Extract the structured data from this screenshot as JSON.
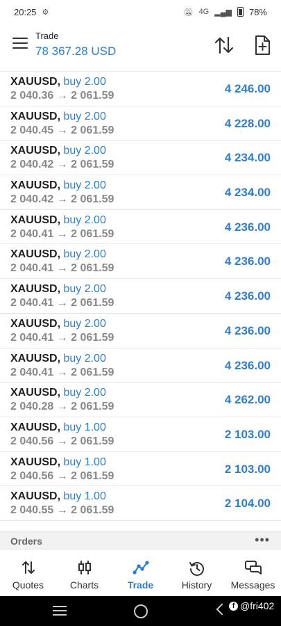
{
  "status_bar": {
    "time": "20:25",
    "network": "4G",
    "battery": "78%",
    "icons": [
      "settings-gear-icon",
      "mute-icon",
      "volte-icon",
      "signal-icon",
      "battery-icon"
    ]
  },
  "header": {
    "title": "Trade",
    "balance": "78 367.28 USD",
    "icons": [
      "menu-icon",
      "sort-icon",
      "new-order-icon"
    ]
  },
  "positions": [
    {
      "symbol": "XAUUSD,",
      "type": "buy 2.00",
      "prices": "2 040.36 → 2 061.59",
      "profit": "4 246.00"
    },
    {
      "symbol": "XAUUSD,",
      "type": "buy 2.00",
      "prices": "2 040.45 → 2 061.59",
      "profit": "4 228.00"
    },
    {
      "symbol": "XAUUSD,",
      "type": "buy 2.00",
      "prices": "2 040.42 → 2 061.59",
      "profit": "4 234.00"
    },
    {
      "symbol": "XAUUSD,",
      "type": "buy 2.00",
      "prices": "2 040.42 → 2 061.59",
      "profit": "4 234.00"
    },
    {
      "symbol": "XAUUSD,",
      "type": "buy 2.00",
      "prices": "2 040.41 → 2 061.59",
      "profit": "4 236.00"
    },
    {
      "symbol": "XAUUSD,",
      "type": "buy 2.00",
      "prices": "2 040.41 → 2 061.59",
      "profit": "4 236.00"
    },
    {
      "symbol": "XAUUSD,",
      "type": "buy 2.00",
      "prices": "2 040.41 → 2 061.59",
      "profit": "4 236.00"
    },
    {
      "symbol": "XAUUSD,",
      "type": "buy 2.00",
      "prices": "2 040.41 → 2 061.59",
      "profit": "4 236.00"
    },
    {
      "symbol": "XAUUSD,",
      "type": "buy 2.00",
      "prices": "2 040.41 → 2 061.59",
      "profit": "4 236.00"
    },
    {
      "symbol": "XAUUSD,",
      "type": "buy 2.00",
      "prices": "2 040.28 → 2 061.59",
      "profit": "4 262.00"
    },
    {
      "symbol": "XAUUSD,",
      "type": "buy 1.00",
      "prices": "2 040.56 → 2 061.59",
      "profit": "2 103.00"
    },
    {
      "symbol": "XAUUSD,",
      "type": "buy 1.00",
      "prices": "2 040.56 → 2 061.59",
      "profit": "2 103.00"
    },
    {
      "symbol": "XAUUSD,",
      "type": "buy 1.00",
      "prices": "2 040.55 → 2 061.59",
      "profit": "2 104.00"
    }
  ],
  "orders": {
    "label": "Orders",
    "more": "•••"
  },
  "tabs": [
    {
      "label": "Quotes",
      "icon": "quotes-arrows-icon"
    },
    {
      "label": "Charts",
      "icon": "candlestick-icon"
    },
    {
      "label": "Trade",
      "icon": "trade-trend-icon",
      "active": true
    },
    {
      "label": "History",
      "icon": "history-clock-icon"
    },
    {
      "label": "Messages",
      "icon": "messages-chat-icon"
    }
  ],
  "watermark": "@fri402",
  "colors": {
    "accent": "#2f7ec7",
    "text": "#222222",
    "muted": "#888888",
    "nav": "#000000"
  }
}
